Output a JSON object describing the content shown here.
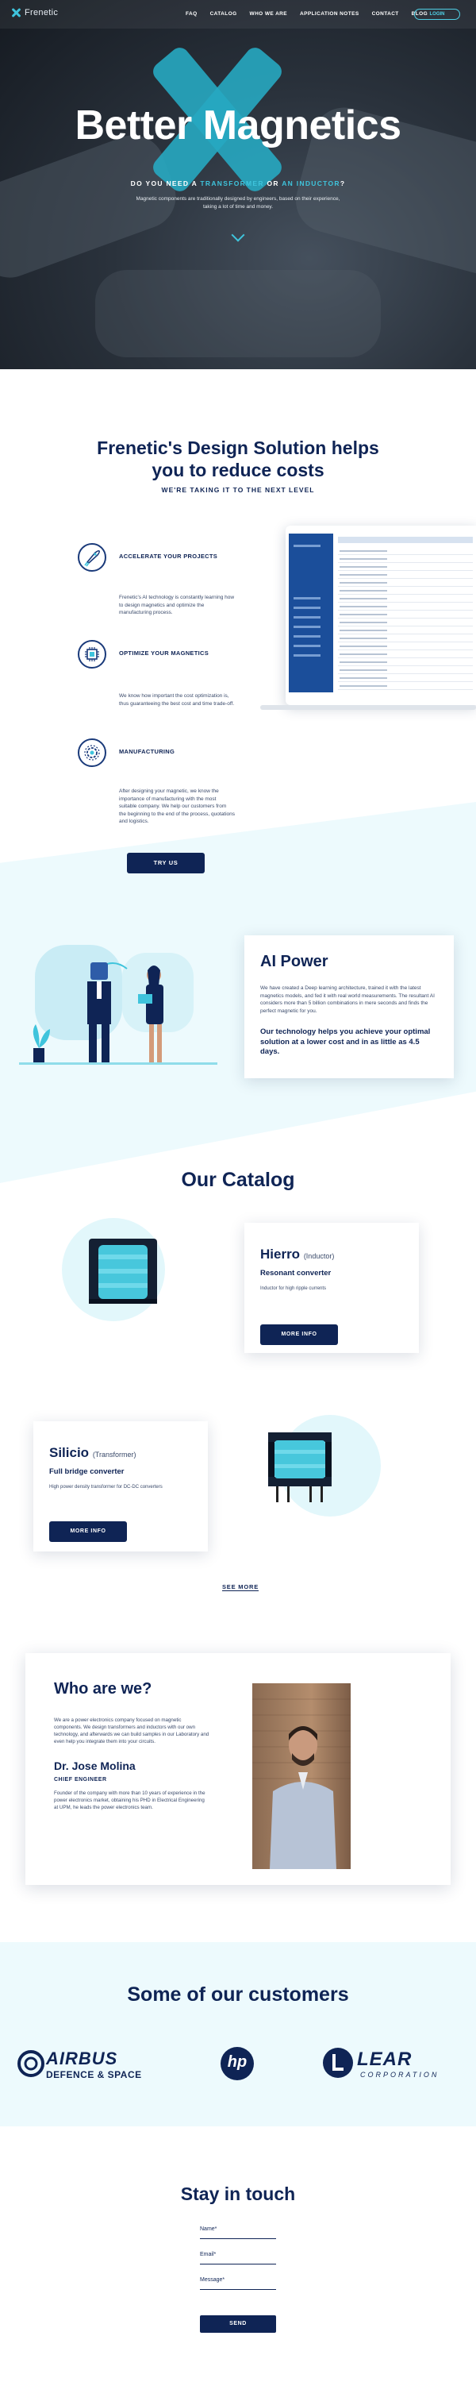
{
  "nav": {
    "brand": "Frenetic",
    "menu": [
      "FAQ",
      "CATALOG",
      "WHO WE ARE",
      "APPLICATION NOTES",
      "CONTACT",
      "BLOG"
    ],
    "login_label": "LOGIN"
  },
  "hero": {
    "title": "Better Magnetics",
    "subtitle_part1": "DO YOU NEED A ",
    "subtitle_highlight1": "TRANSFORMER",
    "subtitle_mid": " OR ",
    "subtitle_highlight2": "AN INDUCTOR",
    "subtitle_end": "?",
    "description": "Magnetic components are traditionally designed by engineers, based on their experience, taking a lot of time and money."
  },
  "design": {
    "title_line1": "Frenetic's Design Solution helps",
    "title_line2": "you to reduce costs",
    "kicker": "WE'RE TAKING IT TO THE NEXT LEVEL",
    "features": [
      {
        "title": "ACCELERATE YOUR PROJECTS",
        "icon": "rocket-icon",
        "desc": "Frenetic's AI technology is constantly learning how to design magnetics and optimize the manufacturing process."
      },
      {
        "title": "OPTIMIZE YOUR MAGNETICS",
        "icon": "chip-icon",
        "desc": "We know how important the cost optimization is, thus guaranteeing the best cost and time trade-off."
      },
      {
        "title": "MANUFACTURING",
        "icon": "gear-icon",
        "desc": "After designing your magnetic, we know the importance of manufacturing with the most suitable company. We help our customers from the beginning to the end of the process, quotations and logistics."
      }
    ],
    "try_label": "TRY US"
  },
  "ai": {
    "title": "AI Power",
    "desc": "We have created a Deep learning architecture, trained it with the latest magnetics models, and fed it with real world measurements. The resultant AI considers more than 5 billion combinations in mere seconds and finds the perfect magnetic for you.",
    "strong": "Our technology helps you achieve your optimal solution at a lower cost and in as little as 4.5 days."
  },
  "catalog": {
    "title": "Our Catalog",
    "products": [
      {
        "name": "Hierro",
        "kind": "(Inductor)",
        "sub": "Resonant converter",
        "desc": "Inductor for high ripple currents",
        "button": "MORE INFO"
      },
      {
        "name": "Silicio",
        "kind": "(Transformer)",
        "sub": "Full bridge converter",
        "desc": "High power density transformer for DC-DC converters",
        "button": "MORE INFO"
      }
    ],
    "see_more": "SEE MORE"
  },
  "who": {
    "title": "Who are we?",
    "desc": "We are a power electronics company focused on magnetic components. We design transformers and inductors with our own technology, and afterwards we can build samples in our Laboratory and even help you integrate them into your circuits.",
    "name": "Dr. Jose Molina",
    "role": "CHIEF ENGINEER",
    "bio": "Founder of the company with more than 10 years of experience in the power electronics market, obtaining his PHD in Electrical Engineering at UPM, he leads the power electronics team."
  },
  "customers": {
    "title": "Some of our customers",
    "airbus_line1": "AIRBUS",
    "airbus_line2": "DEFENCE & SPACE",
    "hp": "hp",
    "lear_main": "LEAR",
    "lear_sub": "CORPORATION"
  },
  "contact": {
    "title": "Stay in touch",
    "name_label": "Name*",
    "email_label": "Email*",
    "message_label": "Message*",
    "send_label": "SEND"
  },
  "colors": {
    "navy": "#0f2455",
    "accent": "#3fc4dc",
    "light_bg": "#edfafd"
  }
}
